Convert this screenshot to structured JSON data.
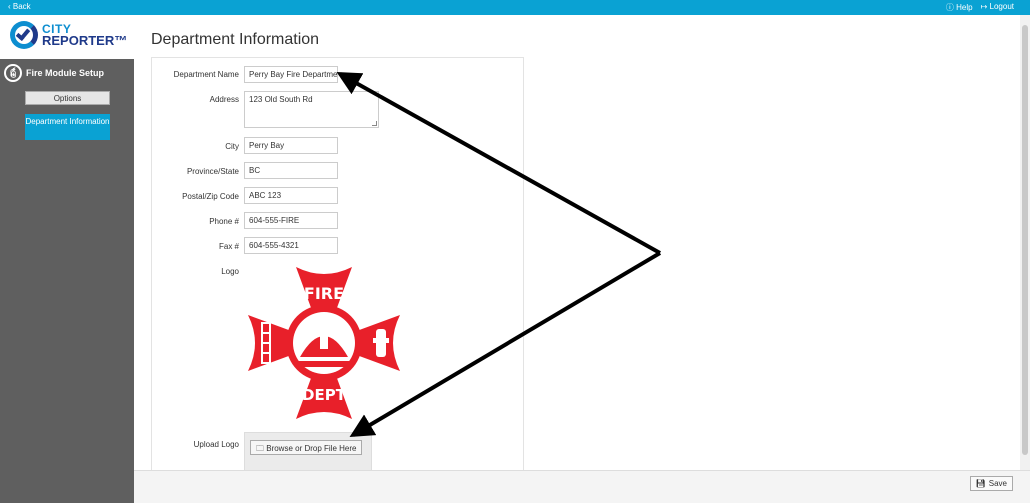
{
  "topbar": {
    "back_label": "‹ Back",
    "help_label": "Help",
    "logout_label": "Logout"
  },
  "brand": {
    "line1": "CITY",
    "line2": "REPORTER™"
  },
  "sidebar": {
    "module_title": "Fire Module Setup",
    "items": [
      {
        "label": "Options"
      },
      {
        "label": "Department Information"
      }
    ]
  },
  "page": {
    "title": "Department Information"
  },
  "form": {
    "department_name": {
      "label": "Department Name",
      "value": "Perry Bay Fire Department"
    },
    "address": {
      "label": "Address",
      "value": "123 Old South Rd"
    },
    "city": {
      "label": "City",
      "value": "Perry Bay"
    },
    "province_state": {
      "label": "Province/State",
      "value": "BC"
    },
    "postal_zip": {
      "label": "Postal/Zip Code",
      "value": "ABC 123"
    },
    "phone": {
      "label": "Phone #",
      "value": "604-555-FIRE"
    },
    "fax": {
      "label": "Fax #",
      "value": "604-555-4321"
    },
    "logo": {
      "label": "Logo",
      "text_top": "FIRE",
      "text_bottom": "DEPT"
    },
    "upload_logo": {
      "label": "Upload Logo",
      "button_label": "Browse or Drop File Here"
    }
  },
  "footer": {
    "save_label": "Save"
  },
  "colors": {
    "accent": "#0aa2d3",
    "sidebar_bg": "#5f5f5f",
    "logo_red": "#e8202a",
    "brand_dark": "#1f3a8a"
  }
}
